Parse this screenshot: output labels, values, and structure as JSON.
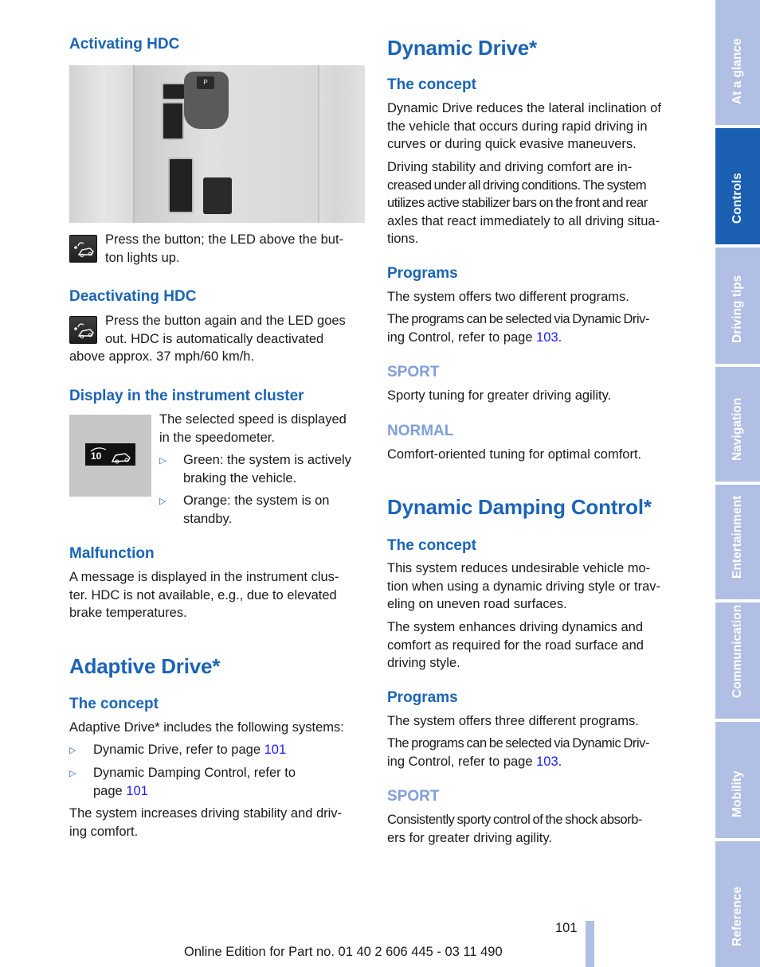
{
  "left": {
    "activating_hdc": {
      "heading": "Activating HDC",
      "photo_alt": "center-console-with-hdc-button",
      "icon": "hdc-button-icon",
      "text": "Press the button; the LED above the but-ton lights up.",
      "line1": "Press the button; the LED above the but-",
      "line2": "ton lights up."
    },
    "deactivating_hdc": {
      "heading": "Deactivating HDC",
      "icon": "hdc-button-icon",
      "line1": "Press the button again and the LED goes",
      "line2": "out. HDC is automatically deactivated",
      "line3": "above approx. 37 mph/60 km/h."
    },
    "display": {
      "heading": "Display in the instrument cluster",
      "cluster_number": "10",
      "line1": "The selected speed is displayed",
      "line2": "in the speedometer.",
      "bullets": [
        {
          "line1": "Green: the system is actively",
          "line2": "braking the vehicle."
        },
        {
          "line1": "Orange: the system is on",
          "line2": "standby."
        }
      ]
    },
    "malfunction": {
      "heading": "Malfunction",
      "line1": "A message is displayed in the instrument clus-",
      "line2": "ter. HDC is not available, e.g., due to elevated",
      "line3": "brake temperatures."
    },
    "adaptive_drive": {
      "title": "Adaptive Drive*",
      "concept_heading": "The concept",
      "intro": "Adaptive Drive* includes the following systems:",
      "bullets": [
        {
          "text": "Dynamic Drive, refer to page ",
          "link": "101"
        },
        {
          "line1": "Dynamic Damping Control, refer to",
          "text2": "page ",
          "link": "101"
        }
      ],
      "outro_line1": "The system increases driving stability and driv-",
      "outro_line2": "ing comfort."
    }
  },
  "right": {
    "dynamic_drive": {
      "title": "Dynamic Drive*",
      "concept_heading": "The concept",
      "p1": [
        "Dynamic Drive reduces the lateral inclination of",
        "the vehicle that occurs during rapid driving in",
        "curves or during quick evasive maneuvers."
      ],
      "p2": [
        "Driving stability and driving comfort are in-",
        "creased under all driving conditions. The system",
        "utilizes active stabilizer bars on the front and rear",
        "axles that react immediately to all driving situa-",
        "tions."
      ],
      "programs_heading": "Programs",
      "programs_p1": "The system offers two different programs.",
      "programs_p2_line1": "The programs can be selected via Dynamic Driv-",
      "programs_p2_line2": "ing Control, refer to page ",
      "programs_link": "103",
      "sport_heading": "SPORT",
      "sport_text": "Sporty tuning for greater driving agility.",
      "normal_heading": "NORMAL",
      "normal_text": "Comfort-oriented tuning for optimal comfort."
    },
    "dynamic_damping": {
      "title": "Dynamic Damping Control*",
      "concept_heading": "The concept",
      "p1": [
        "This system reduces undesirable vehicle mo-",
        "tion when using a dynamic driving style or trav-",
        "eling on uneven road surfaces."
      ],
      "p2": [
        "The system enhances driving dynamics and",
        "comfort as required for the road surface and",
        "driving style."
      ],
      "programs_heading": "Programs",
      "programs_p1": "The system offers three different programs.",
      "programs_p2_line1": "The programs can be selected via Dynamic Driv-",
      "programs_p2_line2": "ing Control, refer to page ",
      "programs_link": "103",
      "sport_heading": "SPORT",
      "sport_line1": "Consistently sporty control of the shock absorb-",
      "sport_line2": "ers for greater driving agility."
    }
  },
  "tabs": [
    {
      "label": "At a glance",
      "active": false
    },
    {
      "label": "Controls",
      "active": true
    },
    {
      "label": "Driving tips",
      "active": false
    },
    {
      "label": "Navigation",
      "active": false
    },
    {
      "label": "Entertainment",
      "active": false
    },
    {
      "label": "Communication",
      "active": false
    },
    {
      "label": "Mobility",
      "active": false
    },
    {
      "label": "Reference",
      "active": false
    }
  ],
  "footer": {
    "page_number": "101",
    "edition": "Online Edition for Part no. 01 40 2 606 445 - 03 11 490"
  },
  "colors": {
    "heading_blue": "#1b64b5",
    "subheading_light_blue": "#7f9fd8",
    "link_blue": "#1a1aff",
    "tab_inactive": "#b1bfe4",
    "tab_active": "#1b5fb3"
  }
}
